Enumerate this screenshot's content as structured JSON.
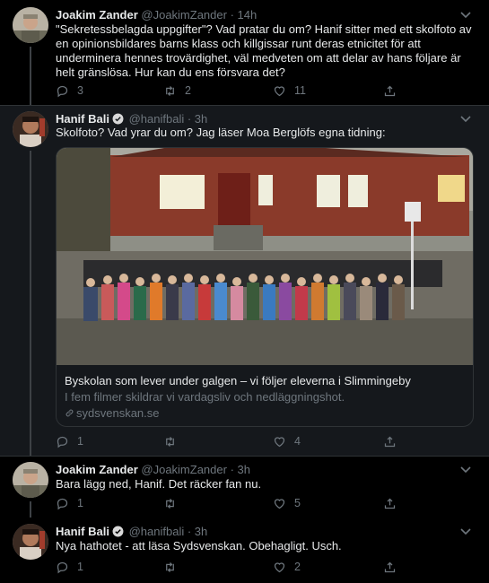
{
  "colors": {
    "background": "#000000",
    "focused_background": "#15181c",
    "accent": "#1d9bf0",
    "muted": "#6e767d",
    "text": "#e7e9ea"
  },
  "tweets": [
    {
      "name": "Joakim Zander",
      "handle": "@JoakimZander",
      "time": "· 14h",
      "verified": false,
      "text": "\"Sekretessbelagda uppgifter\"? Vad pratar du om? Hanif sitter med ett skolfoto av en opinionsbildares barns klass och killgissar runt deras etnicitet för att underminera hennes trovärdighet, väl medveten om att delar av hans följare är helt gränslösa. Hur kan du ens försvara det?",
      "replies": "3",
      "retweets": "2",
      "likes": "11"
    },
    {
      "name": "Hanif Bali",
      "handle": "@hanifbali",
      "time": "· 3h",
      "verified": true,
      "text": "Skolfoto? Vad yrar du om? Jag läser Moa Berglöfs egna tidning:",
      "card": {
        "title": "Byskolan som lever under galgen – vi följer eleverna i Slimmingeby",
        "description": "I fem filmer skildrar vi vardagsliv och nedläggningshot.",
        "domain": "sydsvenskan.se"
      },
      "replies": "1",
      "retweets": "",
      "likes": "4"
    },
    {
      "name": "Joakim Zander",
      "handle": "@JoakimZander",
      "time": "· 3h",
      "verified": false,
      "text": "Bara lägg ned, Hanif. Det räcker fan nu.",
      "replies": "1",
      "retweets": "",
      "likes": "5"
    },
    {
      "name": "Hanif Bali",
      "handle": "@hanifbali",
      "time": "· 3h",
      "verified": true,
      "text": "Nya hathotet - att läsa Sydsvenskan. Obehagligt. Usch.",
      "replies": "1",
      "retweets": "",
      "likes": "2"
    }
  ]
}
